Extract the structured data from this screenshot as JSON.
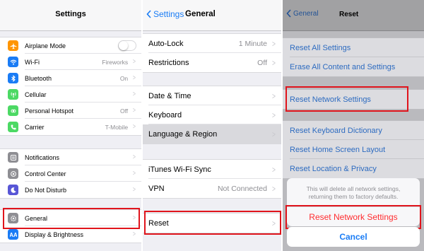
{
  "settings": {
    "title": "Settings",
    "group1": [
      {
        "label": "Airplane Mode",
        "icon": "airplane-icon",
        "color": "#ff9500",
        "value": "",
        "toggle": true
      },
      {
        "label": "Wi-Fi",
        "icon": "wifi-icon",
        "color": "#1a7cf5",
        "value": "Fireworks"
      },
      {
        "label": "Bluetooth",
        "icon": "bluetooth-icon",
        "color": "#1a7cf5",
        "value": "On"
      },
      {
        "label": "Cellular",
        "icon": "cellular-icon",
        "color": "#4cd964",
        "value": ""
      },
      {
        "label": "Personal Hotspot",
        "icon": "hotspot-icon",
        "color": "#4cd964",
        "value": "Off"
      },
      {
        "label": "Carrier",
        "icon": "phone-icon",
        "color": "#4cd964",
        "value": "T-Mobile"
      }
    ],
    "group2": [
      {
        "label": "Notifications",
        "icon": "notifications-icon",
        "color": "#8e8e93",
        "value": ""
      },
      {
        "label": "Control Center",
        "icon": "control-center-icon",
        "color": "#8e8e93",
        "value": ""
      },
      {
        "label": "Do Not Disturb",
        "icon": "moon-icon",
        "color": "#5856d6",
        "value": ""
      }
    ],
    "group3": [
      {
        "label": "General",
        "icon": "gear-icon",
        "color": "#8e8e93",
        "value": ""
      },
      {
        "label": "Display & Brightness",
        "icon": "brightness-icon",
        "color": "#1a7cf5",
        "value": ""
      }
    ]
  },
  "general": {
    "back_label": "Settings",
    "title": "General",
    "group1": [
      {
        "label": "Auto-Lock",
        "value": "1 Minute"
      },
      {
        "label": "Restrictions",
        "value": "Off"
      }
    ],
    "group2": [
      {
        "label": "Date & Time",
        "value": ""
      },
      {
        "label": "Keyboard",
        "value": ""
      },
      {
        "label": "Language & Region",
        "value": ""
      }
    ],
    "group3": [
      {
        "label": "iTunes Wi-Fi Sync",
        "value": ""
      },
      {
        "label": "VPN",
        "value": "Not Connected"
      }
    ],
    "group4": [
      {
        "label": "Reset",
        "value": ""
      }
    ]
  },
  "reset": {
    "back_label": "General",
    "title": "Reset",
    "group1": [
      "Reset All Settings",
      "Erase All Content and Settings"
    ],
    "group2": [
      "Reset Network Settings"
    ],
    "group3": [
      "Reset Keyboard Dictionary",
      "Reset Home Screen Layout",
      "Reset Location & Privacy"
    ],
    "sheet_message": "This will delete all network settings, returning them to factory defaults.",
    "sheet_action": "Reset Network Settings",
    "cancel_label": "Cancel"
  },
  "colors": {
    "highlight": "#e0141c",
    "link": "#1a7cf5",
    "destructive": "#ff2d30"
  }
}
